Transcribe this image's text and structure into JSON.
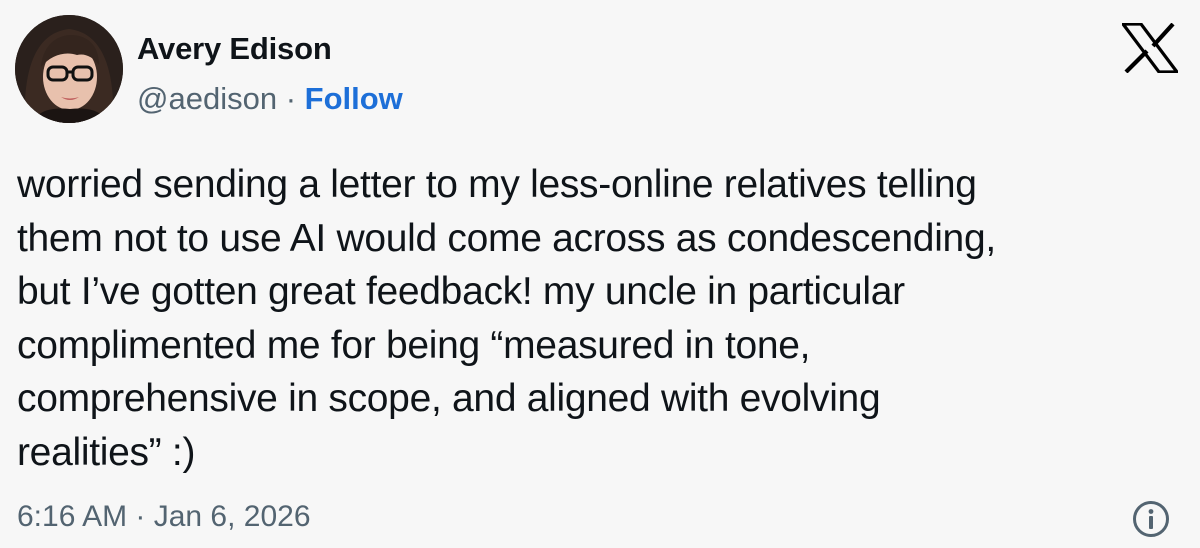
{
  "author": {
    "name": "Avery Edison",
    "handle": "@aedison",
    "separator": "·",
    "follow_label": "Follow"
  },
  "tweet": {
    "lines": [
      "worried sending a letter to my less-online relatives telling",
      "them not to use AI would come across as condescending,",
      "but I’ve gotten great feedback! my uncle in particular",
      "complimented me for being “measured in tone,",
      "comprehensive in scope, and aligned with evolving",
      "realities” :)"
    ],
    "timestamp": "6:16 AM · Jan 6, 2026"
  },
  "icons": {
    "platform": "x-logo-icon",
    "info": "info-icon"
  },
  "colors": {
    "background": "#f7f7f7",
    "text": "#0f1419",
    "secondary": "#536471",
    "follow": "#1d6fd8"
  }
}
